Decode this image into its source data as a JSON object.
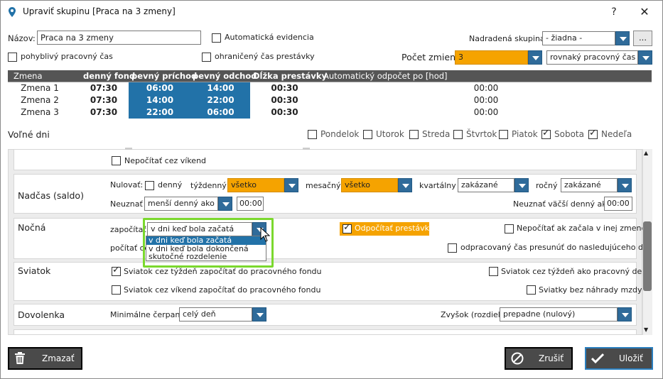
{
  "window": {
    "title": "Upraviť skupinu [Praca na 3 zmeny]",
    "help": "?",
    "close": "✕"
  },
  "form": {
    "nazov_label": "Názov:",
    "nazov_value": "Praca na 3 zmeny",
    "auto_evid": "Automatická evidencia",
    "nadr_label": "Nadradená skupina:",
    "nadr_value": "- žiadna -",
    "dots": "...",
    "pohyblivy": "pohyblivý pracovný čas",
    "ohraniceny": "ohraničený čas prestávky",
    "pocet_label": "Počet zmien",
    "pocet_value": "3",
    "rovnaky": "rovnaký pracovný čas"
  },
  "grid": {
    "headers": [
      "Zmena",
      "denný fond",
      "pevný príchod",
      "pevný odchod",
      "Dĺžka prestávky",
      "Automatický odpočet po [hod]"
    ],
    "rows": [
      [
        "Zmena 1",
        "07:30",
        "06:00",
        "14:00",
        "00:30",
        "00:00"
      ],
      [
        "Zmena 2",
        "07:30",
        "14:00",
        "22:00",
        "00:30",
        "00:00"
      ],
      [
        "Zmena 3",
        "07:30",
        "22:00",
        "06:00",
        "00:30",
        "00:00"
      ]
    ]
  },
  "volne": {
    "label": "Voľné dni",
    "days": [
      {
        "name": "Pondelok",
        "checked": false
      },
      {
        "name": "Utorok",
        "checked": false
      },
      {
        "name": "Streda",
        "checked": false
      },
      {
        "name": "Štvrtok",
        "checked": false
      },
      {
        "name": "Piatok",
        "checked": false
      },
      {
        "name": "Sobota",
        "checked": true
      },
      {
        "name": "Nedeľa",
        "checked": true
      }
    ]
  },
  "panel": {
    "nepocitat_vikend": "Nepočítať cez víkend",
    "nadcas": {
      "title": "Nadčas (saldo)",
      "nulovat": "Nulovať:",
      "denny": "denný",
      "tyzdenny": "týždenný",
      "tyz_val": "všetko",
      "mesacny": "mesačný",
      "mes_val": "všetko",
      "kvartalny": "kvartálny",
      "kv_val": "zakázané",
      "rocny": "ročný",
      "roc_val": "zakázané",
      "neuznat": "Neuznať",
      "neu_val": "menší denný ako",
      "neu_time": "00:00",
      "neuznat_vacsi": "Neuznať väčší denný ako",
      "vac_time": "00:00"
    },
    "nocna": {
      "title": "Nočná",
      "zapocitat": "započítať",
      "zap_val": "v dni keď bola začatá",
      "odpocitat": "Odpočítať prestávku",
      "nepocitat_inej": "Nepočítať ak začala v inej zmene",
      "pocitat": "počítať od",
      "presunut": "odpracovaný čas presunúť do nasledujúceho dňa",
      "options": [
        "v dni keď bola začatá",
        "v dni keď bola dokončená",
        "skutočné rozdelenie"
      ]
    },
    "sviatok": {
      "title": "Sviatok",
      "a": "Sviatok cez týždeň započítať do pracovného fondu",
      "b": "Sviatok cez týždeň ako pracovný deň",
      "c": "Sviatok cez víkend započítať do pracovného fondu",
      "d": "Sviatky bez náhrady mzdy"
    },
    "dovolenka": {
      "title": "Dovolenka",
      "min": "Minimálne čerpanie",
      "min_val": "celý deň",
      "zvysok": "Zvyšok (rozdiel)",
      "zv_val": "prepadne (nulový)"
    }
  },
  "buttons": {
    "delete": "Zmazať",
    "cancel": "Zrušiť",
    "save": "Uložiť"
  },
  "colors": {
    "accent": "#2272a8",
    "orange": "#f5a300",
    "highlight": "#7bd82e"
  }
}
